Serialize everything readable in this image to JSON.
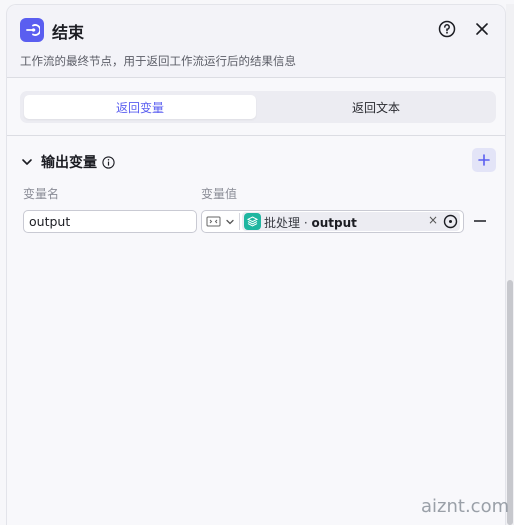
{
  "header": {
    "icon": "end-node-icon",
    "title": "结束",
    "description": "工作流的最终节点，用于返回工作流运行后的结果信息"
  },
  "tabs": [
    {
      "label": "返回变量",
      "active": true
    },
    {
      "label": "返回文本",
      "active": false
    }
  ],
  "output_section": {
    "title": "输出变量",
    "col_name": "变量名",
    "col_value": "变量值",
    "rows": [
      {
        "name": "output",
        "ref_node": "批处理",
        "ref_sep": " · ",
        "ref_var": "output"
      }
    ]
  },
  "colors": {
    "accent": "#5a5ef0",
    "ref_icon": "#1fb6a0"
  },
  "watermark": "aiznt.com"
}
